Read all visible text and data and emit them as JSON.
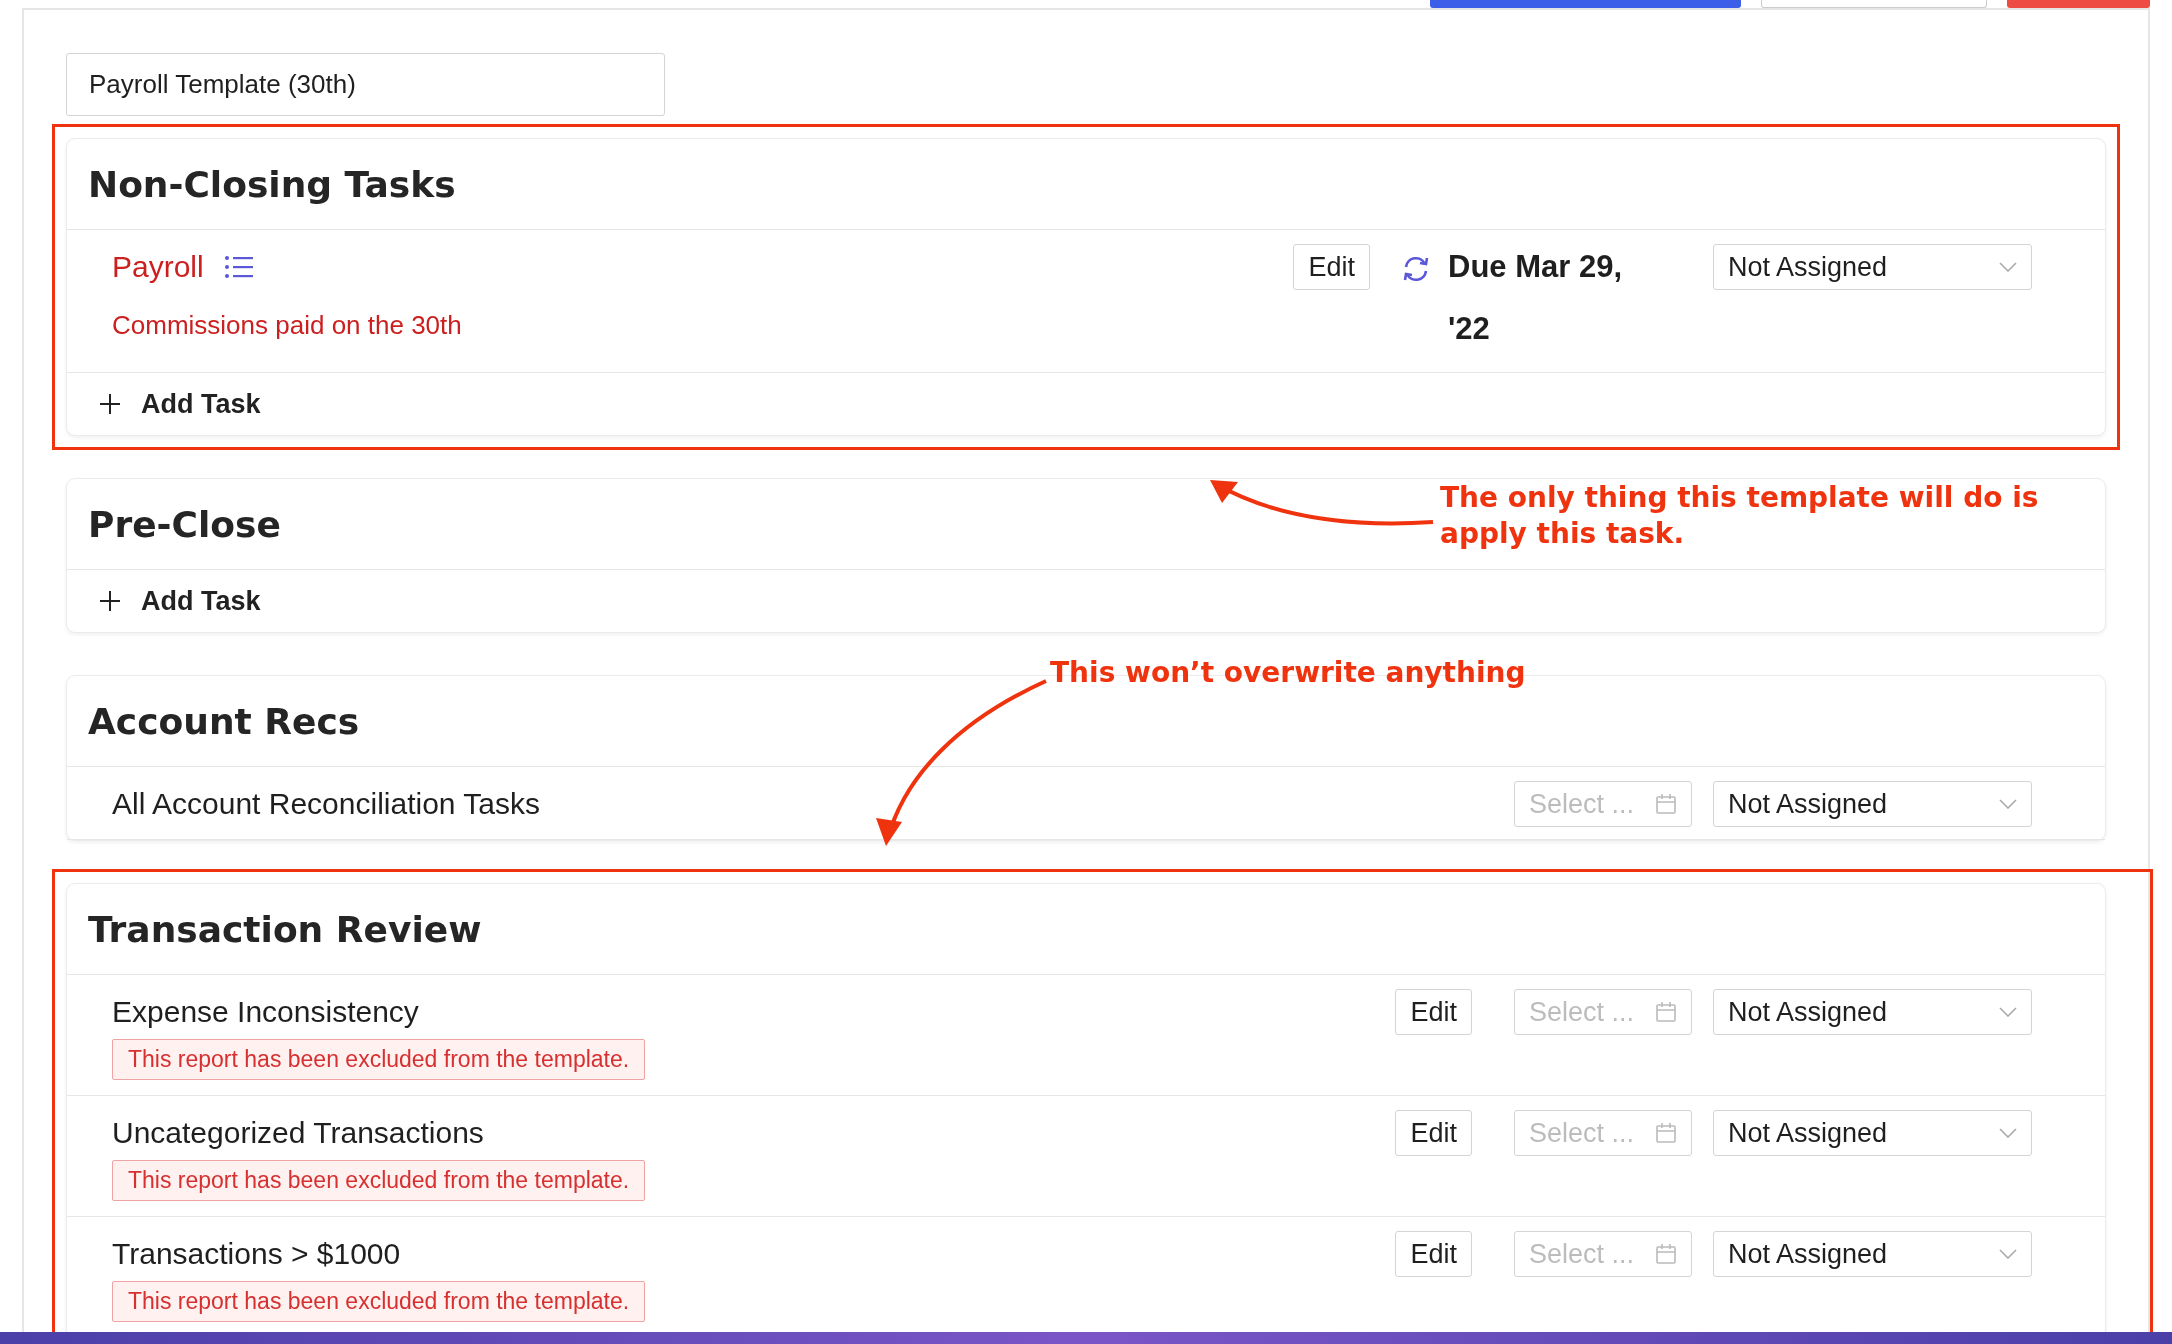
{
  "header_buttons": [
    {
      "kind": "primary"
    },
    {
      "kind": "secondary"
    },
    {
      "kind": "danger"
    }
  ],
  "template_name": {
    "value": "Payroll Template (30th)"
  },
  "sections": [
    {
      "title": "Non-Closing Tasks",
      "highlighted": true,
      "tasks": [
        {
          "kind": "custom",
          "name": "Payroll",
          "description": "Commissions paid on the 30th",
          "edit_label": "Edit",
          "due": "Due Mar 29, '22",
          "recurring": true,
          "assignee": "Not Assigned"
        }
      ],
      "add_label": "Add Task"
    },
    {
      "title": "Pre-Close",
      "highlighted": false,
      "add_label": "Add Task"
    },
    {
      "title": "Account Recs",
      "highlighted": false,
      "tasks": [
        {
          "kind": "group",
          "name": "All Account Reconciliation Tasks",
          "date_placeholder": "Select ...",
          "assignee": "Not Assigned"
        }
      ]
    },
    {
      "title": "Transaction Review",
      "highlighted": true,
      "tasks": [
        {
          "kind": "report",
          "name": "Expense Inconsistency",
          "notice": "This report has been excluded from the template.",
          "edit_label": "Edit",
          "date_placeholder": "Select ...",
          "assignee": "Not Assigned"
        },
        {
          "kind": "report",
          "name": "Uncategorized Transactions",
          "notice": "This report has been excluded from the template.",
          "edit_label": "Edit",
          "date_placeholder": "Select ...",
          "assignee": "Not Assigned"
        },
        {
          "kind": "report",
          "name": "Transactions > $1000",
          "notice": "This report has been excluded from the template.",
          "edit_label": "Edit",
          "date_placeholder": "Select ...",
          "assignee": "Not Assigned"
        }
      ]
    }
  ],
  "annotations": [
    {
      "text": "The only thing this template will do is apply this task."
    },
    {
      "text": "This won’t overwrite anything"
    }
  ]
}
